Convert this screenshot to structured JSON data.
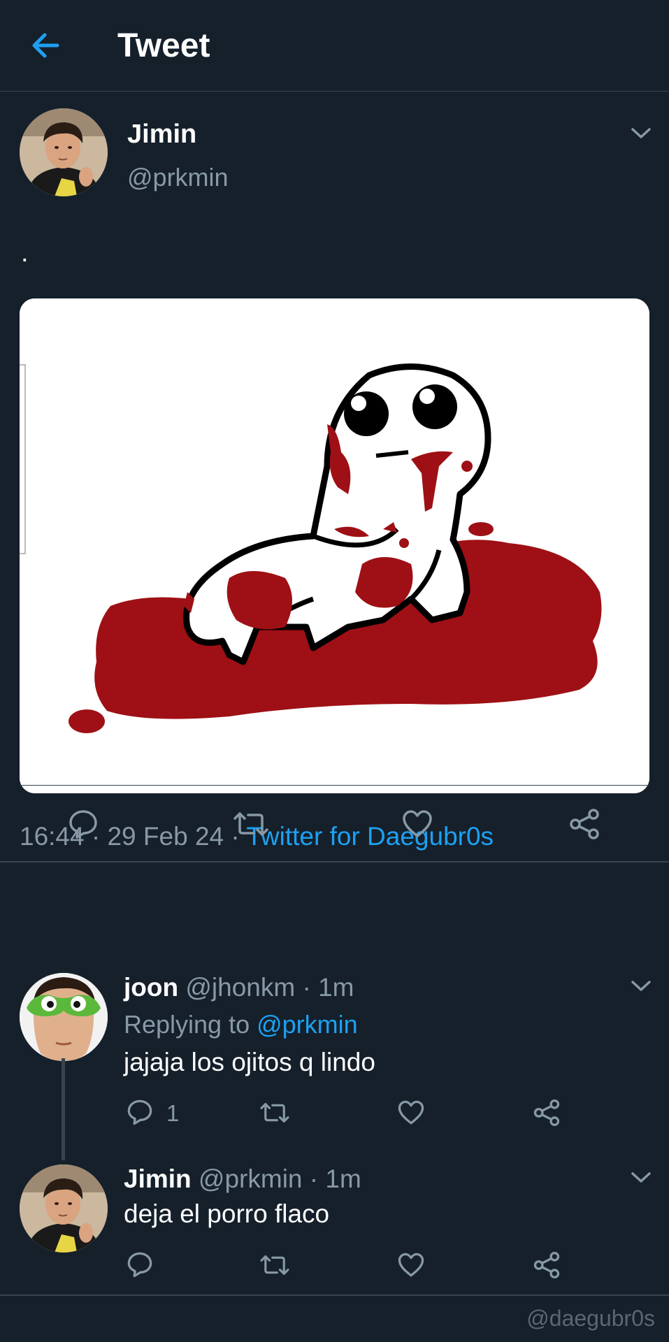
{
  "header": {
    "title": "Tweet",
    "back_icon": "arrow-left-icon"
  },
  "main_tweet": {
    "author_name": "Jimin",
    "author_handle": "@prkmin",
    "text": ".",
    "time": "16:44",
    "date": "29 Feb 24",
    "separator": " · ",
    "source": "Twitter for Daegubr0s",
    "actions": [
      "reply-icon",
      "retweet-icon",
      "like-icon",
      "share-icon"
    ]
  },
  "replies": [
    {
      "name": "joon",
      "handle": "@jhonkm",
      "time": "1m",
      "replying_prefix": "Replying to ",
      "replying_to": "@prkmin",
      "text": "jajaja los ojitos q lindo",
      "reply_count": "1"
    },
    {
      "name": "Jimin",
      "handle": "@prkmin",
      "time": "1m",
      "text": "deja el porro flaco"
    }
  ],
  "watermark": "@daegubr0s",
  "colors": {
    "background": "#15202b",
    "accent": "#1da1f2",
    "muted": "#8899a6",
    "blood": "#9e1015"
  }
}
